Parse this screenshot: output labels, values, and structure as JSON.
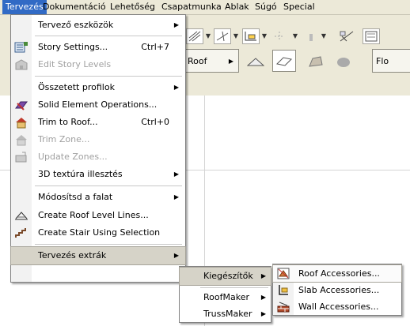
{
  "menubar": {
    "items": [
      "Tervezés",
      "Dokumentáció",
      "Lehetőség",
      "Csapatmunka",
      "Ablak",
      "Súgó",
      "Special"
    ]
  },
  "toolbar": {
    "roof_label": "Roof",
    "floor_label_partial": "Flo"
  },
  "menu": {
    "items": [
      {
        "label": "Tervező eszközök",
        "shortcut": "",
        "submenu": true,
        "disabled": false,
        "icon": ""
      },
      {
        "label": "Story Settings...",
        "shortcut": "Ctrl+7",
        "submenu": false,
        "disabled": false,
        "icon": "story-settings-icon"
      },
      {
        "label": "Edit Story Levels",
        "shortcut": "",
        "submenu": false,
        "disabled": true,
        "icon": "story-levels-icon"
      },
      {
        "label": "Összetett profilok",
        "shortcut": "",
        "submenu": true,
        "disabled": false,
        "icon": ""
      },
      {
        "label": "Solid Element Operations...",
        "shortcut": "",
        "submenu": false,
        "disabled": false,
        "icon": "solid-ops-icon"
      },
      {
        "label": "Trim to Roof...",
        "shortcut": "Ctrl+0",
        "submenu": false,
        "disabled": false,
        "icon": "trim-roof-icon"
      },
      {
        "label": "Trim Zone...",
        "shortcut": "",
        "submenu": false,
        "disabled": true,
        "icon": "trim-zone-icon"
      },
      {
        "label": "Update Zones...",
        "shortcut": "",
        "submenu": false,
        "disabled": true,
        "icon": "update-zones-icon"
      },
      {
        "label": "3D textúra illesztés",
        "shortcut": "",
        "submenu": true,
        "disabled": false,
        "icon": ""
      },
      {
        "label": "Módosítsd a falat",
        "shortcut": "",
        "submenu": true,
        "disabled": false,
        "icon": ""
      },
      {
        "label": "Create Roof Level Lines...",
        "shortcut": "",
        "submenu": false,
        "disabled": false,
        "icon": "roof-lines-icon"
      },
      {
        "label": "Create Stair Using Selection",
        "shortcut": "",
        "submenu": false,
        "disabled": false,
        "icon": "stair-icon"
      },
      {
        "label": "Tervezés extrák",
        "shortcut": "",
        "submenu": true,
        "disabled": false,
        "icon": ""
      }
    ]
  },
  "submenu1": {
    "items": [
      "Kiegészítők",
      "RoofMaker",
      "TrussMaker"
    ]
  },
  "submenu2": {
    "items": [
      {
        "label": "Roof Accessories...",
        "icon": "roof-accessories-icon"
      },
      {
        "label": "Slab Accessories...",
        "icon": "slab-accessories-icon"
      },
      {
        "label": "Wall Accessories...",
        "icon": "wall-accessories-icon"
      }
    ]
  },
  "colors": {
    "menu_highlight": "#316ac5",
    "chrome": "#ece9d8"
  }
}
